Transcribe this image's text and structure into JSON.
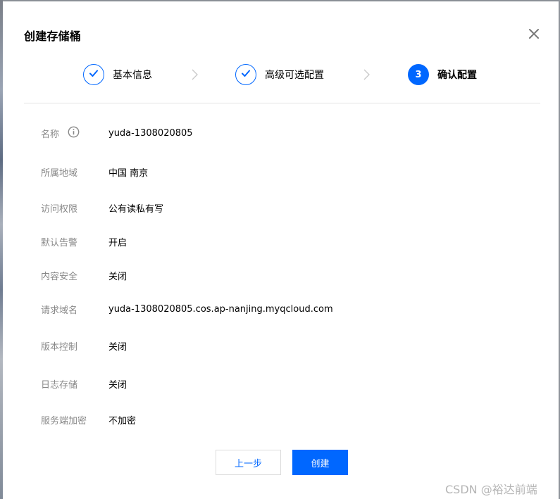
{
  "dialog": {
    "title": "创建存储桶"
  },
  "steps": [
    {
      "label": "基本信息",
      "state": "done"
    },
    {
      "label": "高级可选配置",
      "state": "done"
    },
    {
      "number": "3",
      "label": "确认配置",
      "state": "active"
    }
  ],
  "rows": [
    {
      "label": "名称",
      "value": "yuda-1308020805"
    },
    {
      "label": "所属地域",
      "value": "中国 南京"
    },
    {
      "label": "访问权限",
      "value": "公有读私有写"
    },
    {
      "label": "默认告警",
      "value": "开启"
    },
    {
      "label": "内容安全",
      "value": "关闭"
    },
    {
      "label": "请求域名",
      "value": "yuda-1308020805.cos.ap-nanjing.myqcloud.com"
    },
    {
      "label": "版本控制",
      "value": "关闭"
    },
    {
      "label": "日志存储",
      "value": "关闭"
    },
    {
      "label": "服务端加密",
      "value": "不加密"
    }
  ],
  "buttons": {
    "prev": "上一步",
    "create": "创建"
  },
  "watermark": "CSDN @裕达前端",
  "colors": {
    "accent": "#0067ff",
    "label": "#888888",
    "divider": "#e5e5e5"
  },
  "icons": {
    "close": "close-icon",
    "check": "check-icon",
    "chevron": "chevron-right-icon",
    "info": "info-icon"
  }
}
